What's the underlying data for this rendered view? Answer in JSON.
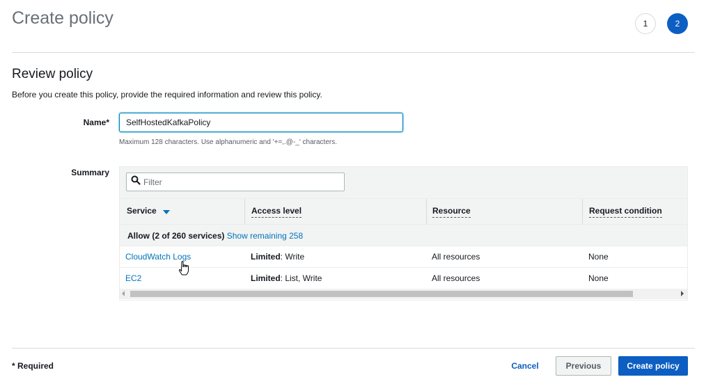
{
  "header": {
    "title": "Create policy",
    "steps": [
      "1",
      "2"
    ],
    "active_step": "2"
  },
  "review": {
    "title": "Review policy",
    "description": "Before you create this policy, provide the required information and review this policy."
  },
  "name_field": {
    "label": "Name*",
    "value": "SelfHostedKafkaPolicy",
    "hint": "Maximum 128 characters. Use alphanumeric and '+=,.@-_' characters."
  },
  "summary": {
    "label": "Summary",
    "filter_placeholder": "Filter",
    "columns": {
      "service": "Service",
      "access_level": "Access level",
      "resource": "Resource",
      "request_condition": "Request condition"
    },
    "group": {
      "label": "Allow (2 of 260 services)",
      "link": "Show remaining 258"
    },
    "rows": [
      {
        "service": "CloudWatch Logs",
        "access_bold": "Limited",
        "access_rest": ": Write",
        "resource": "All resources",
        "condition": "None"
      },
      {
        "service": "EC2",
        "access_bold": "Limited",
        "access_rest": ": List, Write",
        "resource": "All resources",
        "condition": "None"
      }
    ]
  },
  "footer": {
    "required_note": "* Required",
    "cancel": "Cancel",
    "previous": "Previous",
    "create": "Create policy"
  },
  "colors": {
    "primary": "#0d5ec2",
    "link": "#0073bb"
  },
  "icons": [
    "search-icon",
    "sort-down-icon",
    "hand-pointer-icon"
  ]
}
